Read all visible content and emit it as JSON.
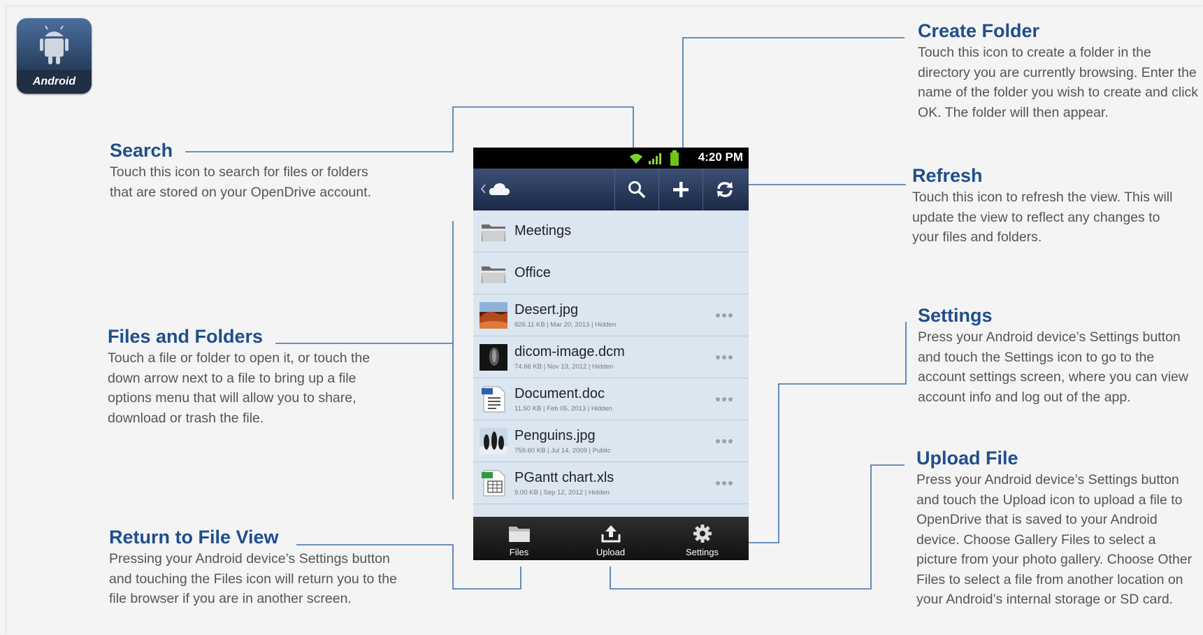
{
  "badge": {
    "label": "Android"
  },
  "callouts": {
    "search": {
      "title": "Search",
      "body": "Touch this icon to search for files or folders that are stored on your OpenDrive account."
    },
    "files_folders": {
      "title": "Files and Folders",
      "body": "Touch a file or folder to open it, or touch the down arrow next to a file to bring up a file options menu that will allow you to share, download or trash the file."
    },
    "return_view": {
      "title": "Return to File View",
      "body": "Pressing your Android device’s Settings button and touching the Files icon will return you to the file browser if you are in another screen."
    },
    "create_folder": {
      "title": "Create Folder",
      "body": "Touch this icon to create a folder in the directory you are currently browsing. Enter the name of the folder you wish to create and click OK. The folder will then appear."
    },
    "refresh": {
      "title": "Refresh",
      "body": "Touch this icon to refresh the view. This will update the view to reflect any changes to your files and folders."
    },
    "settings": {
      "title": "Settings",
      "body": "Press your Android device’s Settings button and touch the Settings icon to go to the account settings screen, where you can view account info and log out of the app."
    },
    "upload": {
      "title": "Upload File",
      "body": "Press your Android device’s Settings button and touch the Upload icon to upload a file to OpenDrive that is saved to your Android device. Choose Gallery Files to select a picture from your photo gallery. Choose Other Files to select a file from another location on your Android’s internal storage or SD card."
    }
  },
  "phone": {
    "status": {
      "time": "4:20 PM"
    },
    "toolbar": {
      "icons": [
        "back-chevron-icon",
        "cloud-icon",
        "search-icon",
        "plus-icon",
        "refresh-icon"
      ]
    },
    "items": [
      {
        "name": "Meetings",
        "type": "folder",
        "icon": "folder-icon"
      },
      {
        "name": "Office",
        "type": "folder",
        "icon": "folder-icon"
      },
      {
        "name": "Desert.jpg",
        "meta": "826.11 KB | Mar 20, 2013 | Hidden",
        "type": "file",
        "icon": "image-thumbnail"
      },
      {
        "name": "dicom-image.dcm",
        "meta": "74.66 KB | Nov 13, 2012 | Hidden",
        "type": "file",
        "icon": "dicom-thumbnail"
      },
      {
        "name": "Document.doc",
        "meta": "11.50 KB | Feb 05, 2013 | Hidden",
        "type": "file",
        "icon": "doc-icon"
      },
      {
        "name": "Penguins.jpg",
        "meta": "759.60 KB | Jul 14, 2009 | Public",
        "type": "file",
        "icon": "image-thumbnail"
      },
      {
        "name": "PGantt chart.xls",
        "meta": "9.00 KB | Sep 12, 2012 | Hidden",
        "type": "file",
        "icon": "xls-icon"
      }
    ],
    "bottombar": {
      "files": "Files",
      "upload": "Upload",
      "settings": "Settings"
    }
  },
  "colors": {
    "heading": "#1f4e8c",
    "line": "#3f6fa8",
    "phone_toolbar": "#2a3b5e",
    "list_bg": "#dbe6f1"
  }
}
